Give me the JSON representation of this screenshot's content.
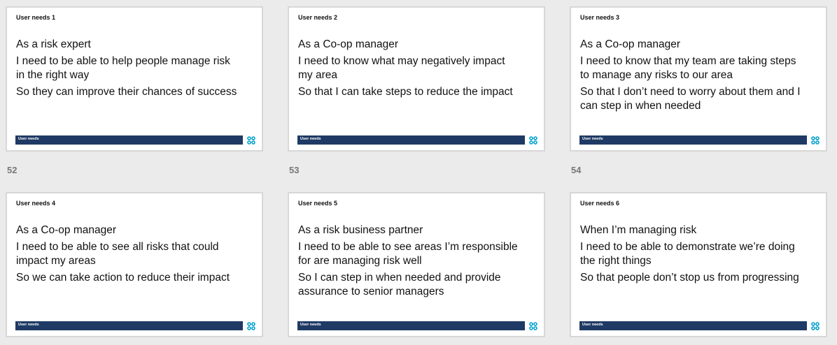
{
  "slides": [
    {
      "title": "User needs 1",
      "lines": [
        "As a risk expert",
        "I need to be able to help people manage risk in the right way",
        "So they can improve their chances of success"
      ],
      "footer": "User needs"
    },
    {
      "title": "User needs 2",
      "lines": [
        "As a Co-op manager",
        "I need to know what may negatively impact my area",
        "So that I can take steps to reduce the impact"
      ],
      "footer": "User needs"
    },
    {
      "title": "User needs 3",
      "lines": [
        "As a Co-op manager",
        "I need to know that my team are taking steps to manage any risks to our area",
        "So that I don’t need to worry about them and I can step in when needed"
      ],
      "footer": "User needs"
    },
    {
      "title": "User needs 4",
      "lines": [
        "As a Co-op manager",
        "I need to be able to see all risks that could impact my areas",
        "So we can take action to reduce their impact"
      ],
      "footer": "User needs"
    },
    {
      "title": "User needs 5",
      "lines": [
        "As a risk business partner",
        "I need to be able to see areas I’m responsible for are managing risk well",
        "So I can step in when needed and provide assurance to senior managers"
      ],
      "footer": "User needs"
    },
    {
      "title": "User needs 6",
      "lines": [
        "When I’m managing risk",
        "I need to be able to demonstrate we’re doing the right things",
        "So that people don’t stop us from progressing"
      ],
      "footer": "User needs"
    }
  ],
  "slide_numbers": [
    "52",
    "53",
    "54"
  ],
  "logo_icon": "coop-clover-icon",
  "colors": {
    "footer_bar": "#1f3a64",
    "logo": "#00a1cc",
    "background": "#ebebeb"
  }
}
